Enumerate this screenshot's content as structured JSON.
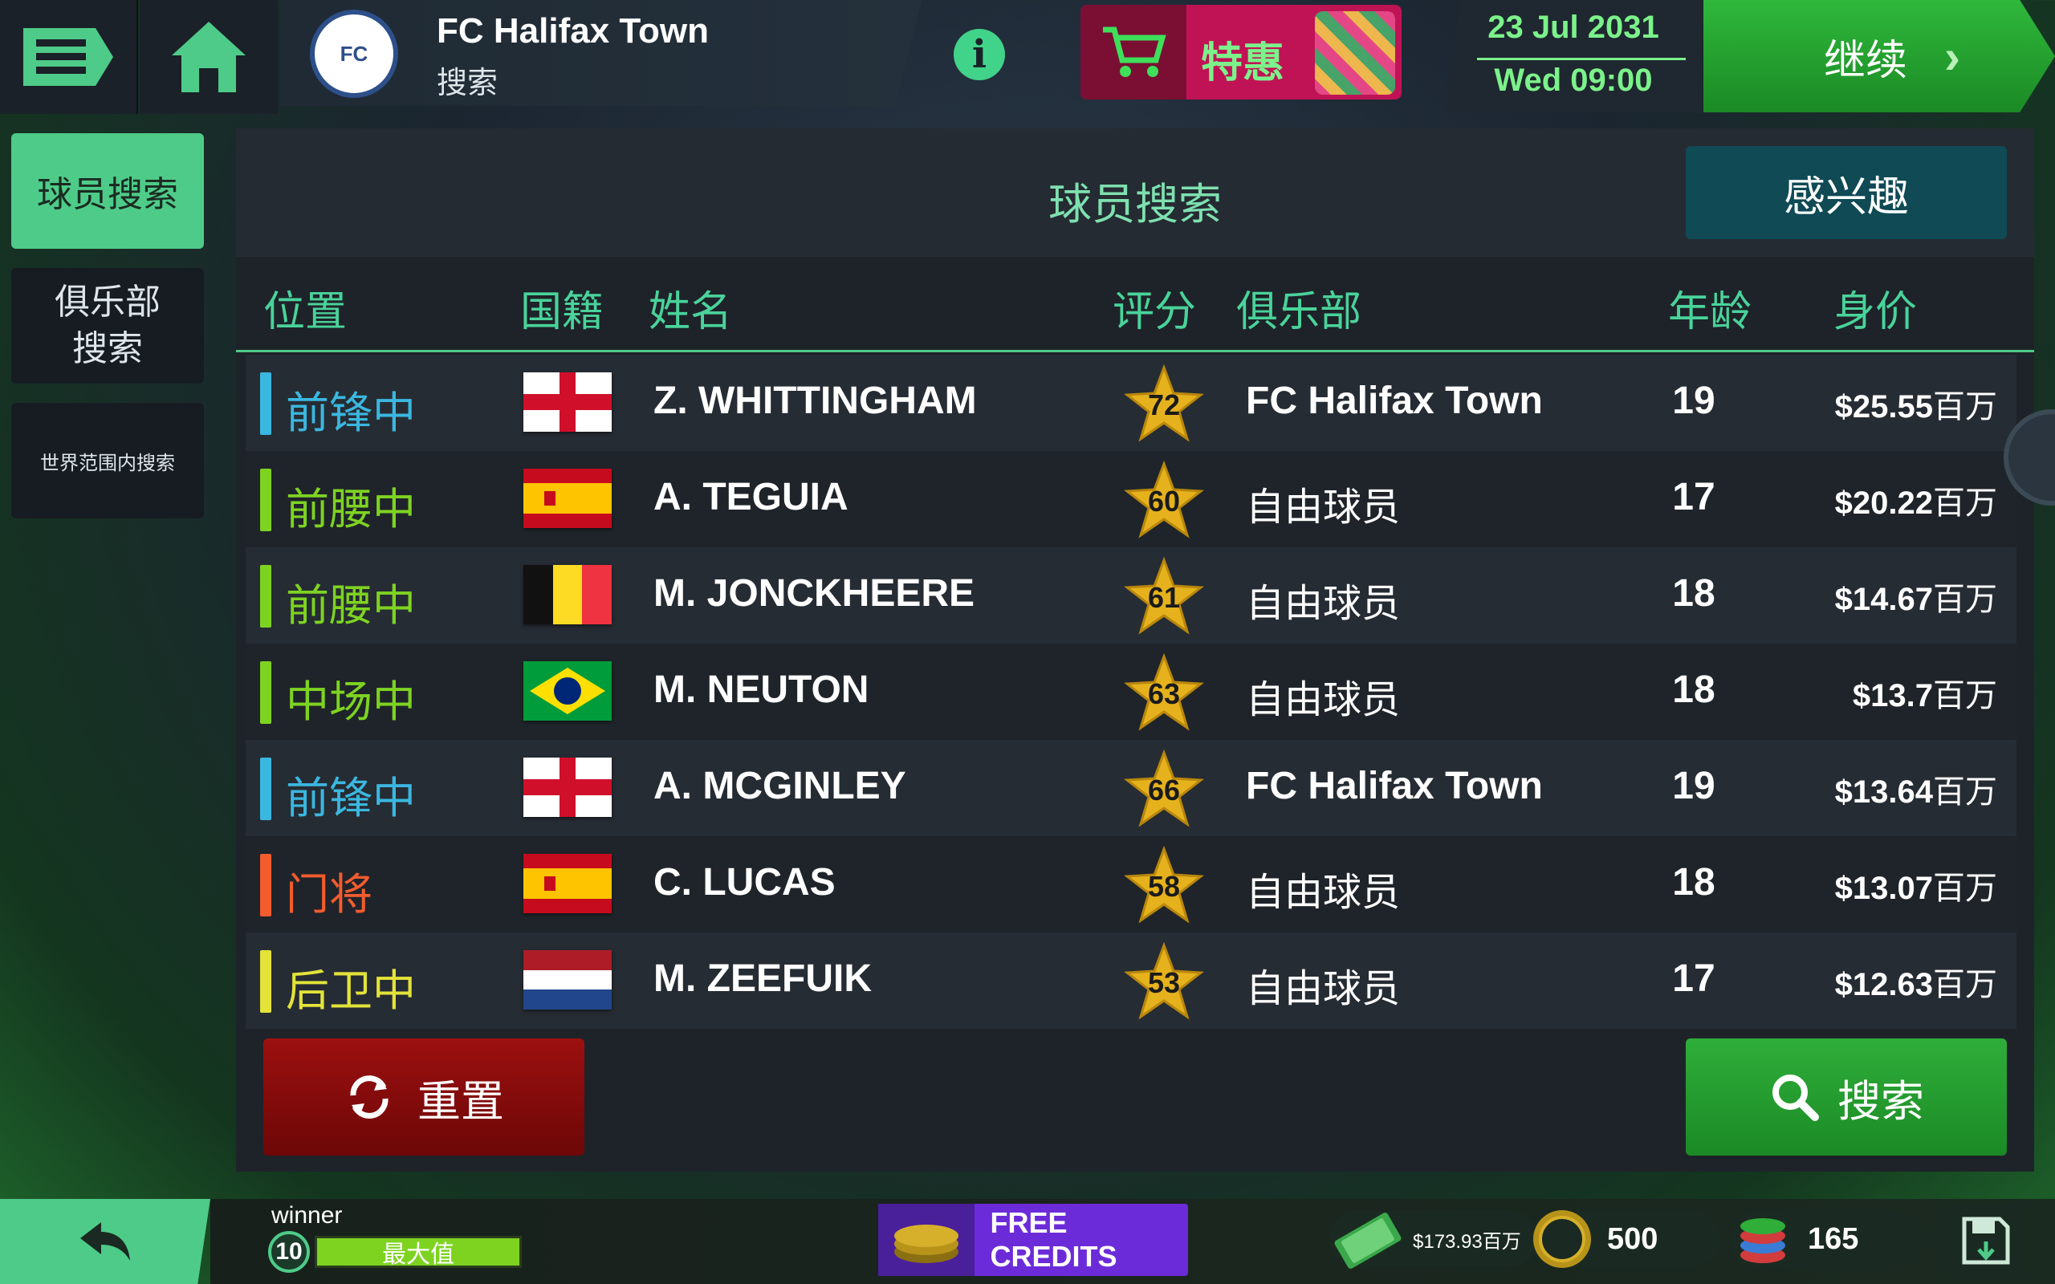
{
  "header": {
    "club_name": "FC Halifax Town",
    "subtitle": "搜索",
    "logo_text": "FC",
    "deal_label": "特惠",
    "date": "23 Jul 2031",
    "time": "Wed 09:00",
    "continue_label": "继续"
  },
  "sidebar": {
    "items": [
      {
        "label": "球员搜索"
      },
      {
        "label": "俱乐部\n搜索"
      },
      {
        "label": "世界范围内搜索"
      }
    ]
  },
  "panel": {
    "title": "球员搜索",
    "interest_label": "感兴趣",
    "columns": {
      "position": "位置",
      "nationality": "国籍",
      "name": "姓名",
      "rating": "评分",
      "club": "俱乐部",
      "age": "年龄",
      "value": "身价"
    },
    "reset_label": "重置",
    "search_label": "搜索"
  },
  "colors": {
    "forward": "#3ab7e0",
    "midfield": "#7ed321",
    "goalkeeper": "#f25c2e",
    "defender": "#e3e33a",
    "accent": "#4ecb88"
  },
  "players": [
    {
      "position": "前锋中",
      "pos_type": "forward",
      "flag": "england",
      "name": "Z. WHITTINGHAM",
      "rating": "72",
      "club": "FC Halifax Town",
      "club_is_team": true,
      "age": "19",
      "value": "$25.55",
      "unit": "百万"
    },
    {
      "position": "前腰中",
      "pos_type": "midfield",
      "flag": "spain",
      "name": "A. TEGUIA",
      "rating": "60",
      "club": "自由球员",
      "club_is_team": false,
      "age": "17",
      "value": "$20.22",
      "unit": "百万"
    },
    {
      "position": "前腰中",
      "pos_type": "midfield",
      "flag": "belgium",
      "name": "M. JONCKHEERE",
      "rating": "61",
      "club": "自由球员",
      "club_is_team": false,
      "age": "18",
      "value": "$14.67",
      "unit": "百万"
    },
    {
      "position": "中场中",
      "pos_type": "midfield",
      "flag": "brazil",
      "name": "M. NEUTON",
      "rating": "63",
      "club": "自由球员",
      "club_is_team": false,
      "age": "18",
      "value": "$13.7",
      "unit": "百万"
    },
    {
      "position": "前锋中",
      "pos_type": "forward",
      "flag": "england",
      "name": "A. MCGINLEY",
      "rating": "66",
      "club": "FC Halifax Town",
      "club_is_team": true,
      "age": "19",
      "value": "$13.64",
      "unit": "百万"
    },
    {
      "position": "门将",
      "pos_type": "goalkeeper",
      "flag": "spain",
      "name": "C. LUCAS",
      "rating": "58",
      "club": "自由球员",
      "club_is_team": false,
      "age": "18",
      "value": "$13.07",
      "unit": "百万"
    },
    {
      "position": "后卫中",
      "pos_type": "defender",
      "flag": "netherlands",
      "name": "M. ZEEFUIK",
      "rating": "53",
      "club": "自由球员",
      "club_is_team": false,
      "age": "17",
      "value": "$12.63",
      "unit": "百万"
    }
  ],
  "footer": {
    "username": "winner",
    "level": "10",
    "level_bar_label": "最大值",
    "free_credits_label": "FREE CREDITS",
    "cash": "$173.93百万",
    "coins": "500",
    "chips": "165"
  }
}
